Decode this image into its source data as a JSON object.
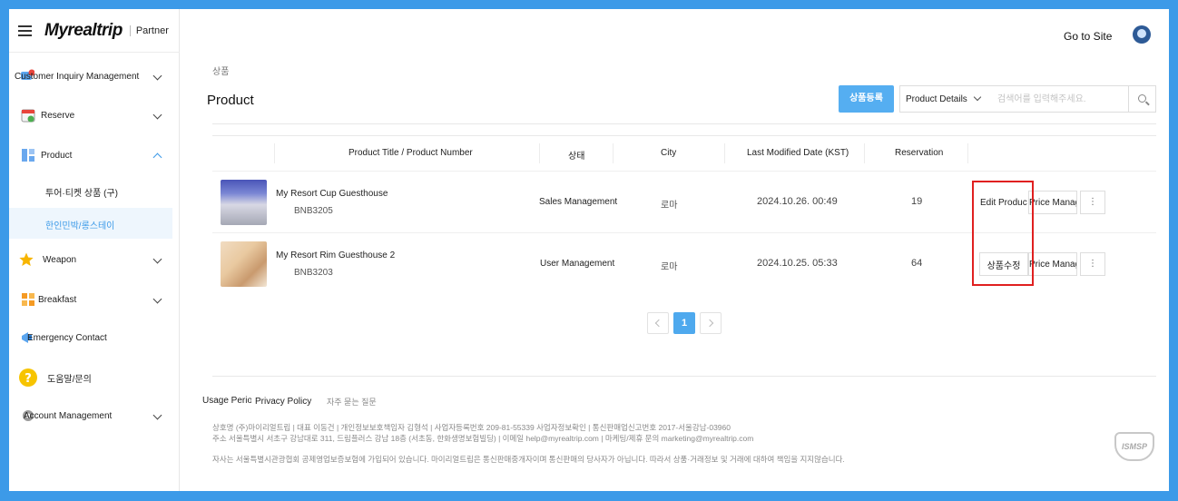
{
  "header": {
    "logo": "Myrealtrip",
    "partner": "Partner",
    "go_to_site": "Go to Site"
  },
  "sidebar": {
    "items": [
      {
        "label": "Customer Inquiry Management"
      },
      {
        "label": "Reserve"
      },
      {
        "label": "Product"
      },
      {
        "label": "Weapon"
      },
      {
        "label": "Breakfast"
      },
      {
        "label": "Emergency Contact"
      },
      {
        "label": "도움말/문의"
      },
      {
        "label": "Account Management"
      }
    ],
    "product_sub": [
      {
        "label": "투어·티켓 상품 (구)"
      },
      {
        "label": "한인민박/롱스테이"
      }
    ]
  },
  "main": {
    "breadcrumb": "상품",
    "title": "Product",
    "register_button": "상품등록",
    "search_type": "Product Details",
    "search_placeholder": "검색어를 입력해주세요."
  },
  "table": {
    "columns": [
      "Product Title / Product Number",
      "상태",
      "City",
      "Last Modified Date (KST)",
      "Reservation"
    ],
    "rows": [
      {
        "title": "My Resort Cup Guesthouse",
        "number": "BNB3205",
        "status": "Sales Management",
        "city": "로마",
        "modified": "2024.10.26. 00:49",
        "reservation": "19",
        "edit_label": "Edit Product",
        "price_label": "Price Management",
        "more_label": "⋮"
      },
      {
        "title": "My Resort Rim Guesthouse 2",
        "number": "BNB3203",
        "status": "User Management",
        "city": "로마",
        "modified": "2024.10.25. 05:33",
        "reservation": "64",
        "edit_label": "상품수정",
        "price_label": "Price Management",
        "more_label": "⋮"
      }
    ]
  },
  "pagination": {
    "current": "1"
  },
  "footer": {
    "usage_period": "Usage Period",
    "privacy_policy": "Privacy Policy",
    "faq": "자주 묻는 질문",
    "company_line1": "상호명 (주)마이리얼트립 | 대표 이동건 | 개인정보보호책임자 김형석 | 사업자등록번호 209-81-55339 사업자정보확인 | 통신판매업신고번호 2017-서울강남-03960",
    "company_line2": "주소 서울특별시 서초구 강남대로 311, 드림플러스 강남 18층 (서초동, 한화생명보험빌딩) | 이메일 help@myrealtrip.com | 마케팅/제휴 문의 marketing@myrealtrip.com",
    "disclaimer": "자사는 서울특별시관광협회 공제영업보증보험에 가입되어 있습니다. 마이리얼트립은 통신판매중개자이며 통신판매의 당사자가 아닙니다. 따라서 상품·거래정보 및 거래에 대하여 책임을 지지않습니다.",
    "badge": "ISMSP"
  },
  "colors": {
    "accent": "#55aef1",
    "frame": "#3c9ae8",
    "highlight": "#e02020"
  }
}
